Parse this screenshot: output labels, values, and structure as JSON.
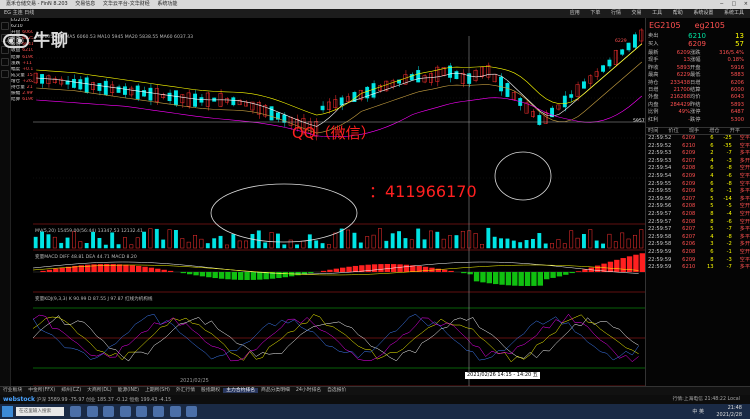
{
  "window": {
    "title": "嘉禾仓储交易 - FinN 8.203",
    "tabs": [
      "交易信息",
      "文华云平台-文华财经",
      "系统功能"
    ],
    "buttons": [
      "−",
      "□",
      "×"
    ]
  },
  "menu": {
    "left": "EG 主连 日线",
    "items": [
      "应用",
      "下单",
      "行情",
      "交易",
      "工具",
      "帮助",
      "系统设置",
      "系统工具"
    ]
  },
  "watermark": {
    "text": "牛聊"
  },
  "contact": {
    "line1": "QQ（微信）",
    "line2": "：411966170"
  },
  "left_panel": {
    "rows": [
      [
        "EG2105"
      ],
      [
        "6210"
      ],
      [
        "开盘",
        "6060"
      ],
      [
        "最高",
        "6225"
      ],
      [
        "最低",
        "6041"
      ],
      [
        "收盘",
        "6210"
      ],
      [
        "结算",
        "6196"
      ],
      [
        "涨跌",
        "+11"
      ],
      [
        "幅度",
        "+0.17%"
      ],
      [
        "成交量",
        "15459"
      ],
      [
        "增仓",
        "+2627"
      ],
      [
        "持仓量",
        "21.7万"
      ],
      [
        "振幅",
        "2.99%"
      ],
      [
        "结算",
        "6196"
      ]
    ]
  },
  "price_panel": {
    "labels": {
      "top": "6229",
      "hline": "5957",
      "mid": "5800",
      "low1": "5600",
      "low2": "5400",
      "l3": "5200"
    },
    "ma_legend": "EG2105 日线 MA5 6060.53  MA10 5945  MA20 5838.55  MA60 6037.33"
  },
  "vol_panel": {
    "legend": "MV(5,20)  15459.00(56:44)  13347.53  12132.41"
  },
  "macd_panel": {
    "legend": "变量MACD  DIFF 48.81  DEA 44.71  MACD 8.20"
  },
  "kdj_panel": {
    "legend": "变量KDJ(9,3,3)  K 90.99  D 87.55  J 97.87  红线为机构线"
  },
  "cursor": {
    "datetime": "2021/02/26 14:15 - 14:20 五"
  },
  "date_label": "2021/02/25",
  "right_panel": {
    "code_left": "EG2105",
    "code_right": "eg2105",
    "quote": [
      {
        "label": "卖出",
        "price": "6210",
        "qty": "13"
      },
      {
        "label": "买入",
        "price": "6209",
        "qty": "57"
      }
    ],
    "grid": [
      "最新",
      "6209",
      "涨跌",
      "316/5.4%",
      "现手",
      "13",
      "涨幅",
      "0.18%",
      "昨收",
      "5893",
      "开盘",
      "5916",
      "最高",
      "6229",
      "最低",
      "5883",
      "持仓",
      "233438",
      "日增",
      "6206",
      "日增",
      "21700",
      "结算",
      "6000",
      "外盘",
      "216268",
      "均价",
      "6043",
      "内盘",
      "284429",
      "昨结",
      "5893",
      "比例",
      "49%",
      "涨停",
      "6487",
      "红利",
      "-",
      "跌停",
      "5300"
    ],
    "ticks_header": [
      "时间",
      "价位",
      "现手",
      "增仓",
      "开平"
    ],
    "ticks": [
      [
        "22:59:52",
        "6209",
        "6",
        "-25",
        "空平"
      ],
      [
        "22:59:52",
        "6210",
        "6",
        "-35",
        "空平"
      ],
      [
        "22:59:53",
        "6209",
        "2",
        "-7",
        "多平"
      ],
      [
        "22:59:53",
        "6207",
        "4",
        "-3",
        "多开"
      ],
      [
        "22:59:54",
        "6208",
        "6",
        "-8",
        "空开"
      ],
      [
        "22:59:54",
        "6209",
        "4",
        "-6",
        "空平"
      ],
      [
        "22:59:55",
        "6209",
        "6",
        "-8",
        "空平"
      ],
      [
        "22:59:55",
        "6209",
        "6",
        "-1",
        "多平"
      ],
      [
        "22:59:56",
        "6207",
        "5",
        "-14",
        "多平"
      ],
      [
        "22:59:56",
        "6208",
        "5",
        "-5",
        "空开"
      ],
      [
        "22:59:57",
        "6208",
        "8",
        "-4",
        "空开"
      ],
      [
        "22:59:57",
        "6208",
        "8",
        "-6",
        "空开"
      ],
      [
        "22:59:57",
        "6207",
        "5",
        "-7",
        "多平"
      ],
      [
        "22:59:58",
        "6207",
        "4",
        "-8",
        "多平"
      ],
      [
        "22:59:58",
        "6206",
        "3",
        "-2",
        "多开"
      ],
      [
        "22:59:59",
        "6208",
        "6",
        "-1",
        "空开"
      ],
      [
        "22:59:59",
        "6209",
        "8",
        "-3",
        "空平"
      ],
      [
        "22:59:59",
        "6210",
        "13",
        "-7",
        "多平"
      ]
    ]
  },
  "tabs": [
    "行业板块",
    "中金所(FFX)",
    "郑州(CZ)",
    "大商所(DL)",
    "能源(INE)",
    "上期所(SH)",
    "外汇行情",
    "股指期权",
    "主力合约排名",
    "商品分类明细",
    "24小时排名",
    "自选报价"
  ],
  "status": {
    "logo": "webstock",
    "text": "沪深 3589.99 -75.97  创业 185.37 -0.12  恒指 199.43 -4.15",
    "right": "行情:上海电信  21:48:22 Local"
  },
  "taskbar": {
    "search": "在这里输入搜索",
    "time": "21:48",
    "date": "2021/2/28",
    "sys": "中 英"
  },
  "colors": {
    "up": "#ff3030",
    "down": "#00e5e5",
    "ma5": "#ffffff",
    "ma10": "#ffff00",
    "ma20": "#ff00ff",
    "ma60": "#00ff00"
  }
}
